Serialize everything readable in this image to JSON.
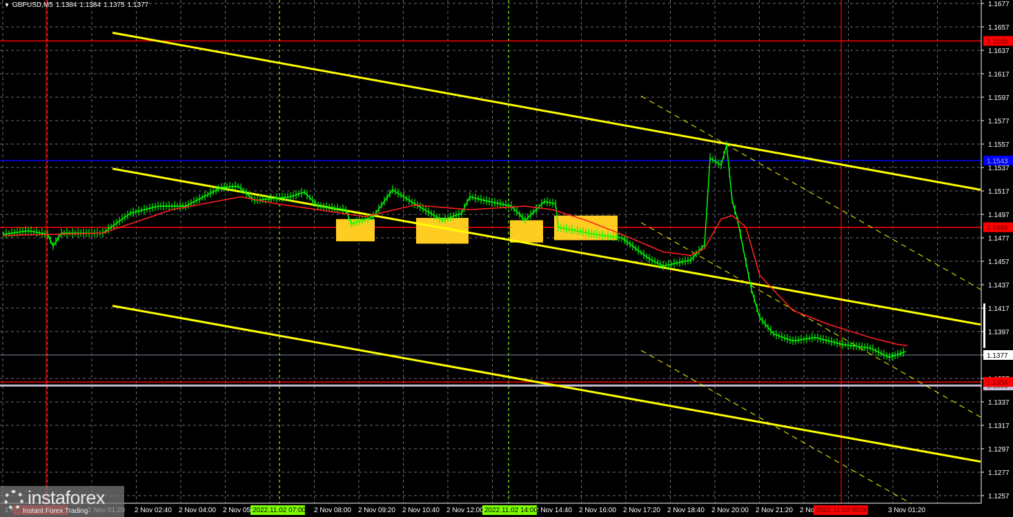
{
  "header": {
    "symbol": "GBPUSD,M5",
    "open": "1.1384",
    "high": "1.1384",
    "low": "1.1375",
    "close": "1.1377"
  },
  "logo": {
    "brand": "instaforex",
    "tagline": "Instant Forex Trading"
  },
  "colors": {
    "bg": "#000000",
    "candles": "#00ff00",
    "ma": "#ff2020",
    "channel": "#ffff00",
    "level_red": "#ff0000",
    "level_blue": "#0000ff",
    "grid": "#8a8a9a"
  },
  "chart_data": {
    "type": "line",
    "title": "GBPUSD,M5",
    "ylim": [
      1.125,
      1.1685
    ],
    "bar_minutes": 5,
    "grid": true,
    "y_ticks": [
      "1.1677",
      "1.1657",
      "1.1637",
      "1.1617",
      "1.1597",
      "1.1577",
      "1.1557",
      "1.1537",
      "1.1517",
      "1.1497",
      "1.1477",
      "1.1457",
      "1.1437",
      "1.1417",
      "1.1397",
      "1.1377",
      "1.1357",
      "1.1337",
      "1.1317",
      "1.1297",
      "1.1277",
      "1.1257"
    ],
    "x_labels": [
      {
        "bar": 0,
        "text": "1 Nov"
      },
      {
        "bar": 30,
        "text": "2 Nov 01:20"
      },
      {
        "bar": 47,
        "text": "2 Nov 02:40"
      },
      {
        "bar": 63,
        "text": "2 Nov 04:00"
      },
      {
        "bar": 79,
        "text": "2 Nov 05:20"
      },
      {
        "bar": 112,
        "text": "2 Nov 08:00"
      },
      {
        "bar": 128,
        "text": "2 Nov 09:20"
      },
      {
        "bar": 144,
        "text": "2 Nov 10:40"
      },
      {
        "bar": 160,
        "text": "2 Nov 12:00"
      },
      {
        "bar": 192,
        "text": "2 Nov 14:40"
      },
      {
        "bar": 208,
        "text": "2 Nov 16:00"
      },
      {
        "bar": 224,
        "text": "2 Nov 17:20"
      },
      {
        "bar": 240,
        "text": "2 Nov 18:40"
      },
      {
        "bar": 256,
        "text": "2 Nov 20:00"
      },
      {
        "bar": 272,
        "text": "2 Nov 21:20"
      },
      {
        "bar": 288,
        "text": "2 Nov 22:40"
      },
      {
        "bar": 320,
        "text": "3 Nov 01:20"
      }
    ],
    "x_markers": [
      {
        "bar": 90,
        "text": "2022.11.02 07:00",
        "color": "#7fff00"
      },
      {
        "bar": 174,
        "text": "2022.11.02 14:00",
        "color": "#7fff00"
      },
      {
        "bar": 294,
        "text": "2022.11.03 00:00",
        "color": "#ff0000"
      },
      {
        "bar": 4,
        "text": "2022.11.02 00:00",
        "color": "#ff0000"
      }
    ],
    "vertical_lines": [
      {
        "bar": 15.5,
        "color": "#ff0000"
      },
      {
        "bar": 303.5,
        "color": "#ff0000"
      },
      {
        "bar": 100,
        "color": "#7fff00",
        "dashed": true
      },
      {
        "bar": 183,
        "color": "#7fff00",
        "dashed": true
      }
    ],
    "levels": [
      {
        "price": 1.1645,
        "label": "1.1645",
        "color": "#ff0000"
      },
      {
        "price": 1.1543,
        "label": "1.1543",
        "color": "#0000ff"
      },
      {
        "price": 1.1486,
        "label": "1.1486",
        "color": "#ff0000"
      },
      {
        "price": 1.1354,
        "label": "1.1354",
        "color": "#ff0000"
      },
      {
        "price": 1.1351,
        "label": "1.1351",
        "color": "#c8c0d8"
      }
    ],
    "current_price": {
      "price": 1.1377,
      "label": "1.1377"
    },
    "price_series": [
      [
        0,
        1.148
      ],
      [
        9,
        1.1483
      ],
      [
        16,
        1.148
      ],
      [
        18,
        1.147
      ],
      [
        21,
        1.1481
      ],
      [
        36,
        1.1481
      ],
      [
        46,
        1.1498
      ],
      [
        56,
        1.1504
      ],
      [
        66,
        1.1504
      ],
      [
        79,
        1.152
      ],
      [
        85,
        1.1521
      ],
      [
        91,
        1.1509
      ],
      [
        104,
        1.1512
      ],
      [
        109,
        1.1516
      ],
      [
        114,
        1.1504
      ],
      [
        124,
        1.1501
      ],
      [
        126,
        1.1489
      ],
      [
        134,
        1.1495
      ],
      [
        141,
        1.1518
      ],
      [
        149,
        1.1506
      ],
      [
        159,
        1.1492
      ],
      [
        166,
        1.1498
      ],
      [
        169,
        1.1512
      ],
      [
        174,
        1.1509
      ],
      [
        184,
        1.1504
      ],
      [
        189,
        1.1492
      ],
      [
        196,
        1.1508
      ],
      [
        200,
        1.1506
      ],
      [
        201,
        1.1486
      ],
      [
        214,
        1.148
      ],
      [
        224,
        1.1477
      ],
      [
        234,
        1.1459
      ],
      [
        239,
        1.1453
      ],
      [
        249,
        1.1458
      ],
      [
        254,
        1.1471
      ],
      [
        256,
        1.1545
      ],
      [
        260,
        1.1539
      ],
      [
        262,
        1.1556
      ],
      [
        264,
        1.1509
      ],
      [
        266,
        1.1492
      ],
      [
        269,
        1.1456
      ],
      [
        271,
        1.1433
      ],
      [
        274,
        1.1409
      ],
      [
        279,
        1.1395
      ],
      [
        286,
        1.1389
      ],
      [
        294,
        1.1392
      ],
      [
        304,
        1.1386
      ],
      [
        314,
        1.1383
      ],
      [
        321,
        1.1375
      ],
      [
        327,
        1.138
      ]
    ],
    "ma_series": [
      [
        0,
        1.1479
      ],
      [
        36,
        1.1481
      ],
      [
        61,
        1.1501
      ],
      [
        86,
        1.1512
      ],
      [
        99,
        1.1506
      ],
      [
        114,
        1.1501
      ],
      [
        131,
        1.1495
      ],
      [
        149,
        1.1505
      ],
      [
        169,
        1.1501
      ],
      [
        189,
        1.1504
      ],
      [
        199,
        1.1501
      ],
      [
        211,
        1.1492
      ],
      [
        224,
        1.148
      ],
      [
        239,
        1.1465
      ],
      [
        249,
        1.1462
      ],
      [
        254,
        1.1468
      ],
      [
        260,
        1.1493
      ],
      [
        264,
        1.1496
      ],
      [
        269,
        1.1486
      ],
      [
        274,
        1.1445
      ],
      [
        286,
        1.1415
      ],
      [
        299,
        1.1403
      ],
      [
        314,
        1.1392
      ],
      [
        324,
        1.1386
      ],
      [
        327.5,
        1.1385
      ]
    ],
    "channel_lines": [
      {
        "from": [
          39.5,
          1.1652
        ],
        "to": [
          354,
          1.1518
        ],
        "style": "solid"
      },
      {
        "from": [
          39.5,
          1.1536
        ],
        "to": [
          354,
          1.1403
        ],
        "style": "solid"
      },
      {
        "from": [
          39.5,
          1.1419
        ],
        "to": [
          354,
          1.1286
        ],
        "style": "solid"
      },
      {
        "from": [
          231,
          1.1598
        ],
        "to": [
          354,
          1.1433
        ],
        "style": "dashed"
      },
      {
        "from": [
          231,
          1.149
        ],
        "to": [
          354,
          1.1324
        ],
        "style": "dashed"
      },
      {
        "from": [
          231,
          1.1381
        ],
        "to": [
          329,
          1.125
        ],
        "style": "dashed"
      }
    ],
    "signal_boxes": [
      {
        "bars": [
          120.5,
          134.5
        ],
        "prices": [
          1.1474,
          1.1493
        ]
      },
      {
        "bars": [
          149.5,
          168.5
        ],
        "prices": [
          1.1472,
          1.1494
        ]
      },
      {
        "bars": [
          183.5,
          195.5
        ],
        "prices": [
          1.1473,
          1.1492
        ]
      },
      {
        "bars": [
          199.5,
          222.5
        ],
        "prices": [
          1.1475,
          1.1496
        ]
      }
    ]
  }
}
